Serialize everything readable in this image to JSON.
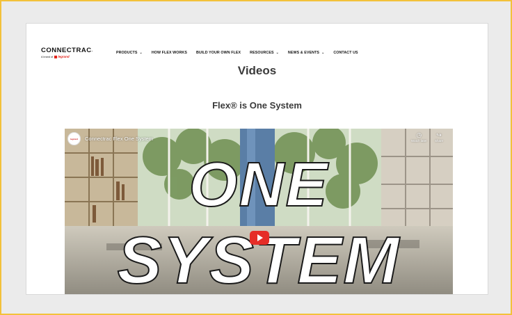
{
  "brand": {
    "name": "CONNECTRAC",
    "mark": ".",
    "tagline_prefix": "A brand of",
    "parent": "legrand"
  },
  "nav": [
    {
      "label": "PRODUCTS",
      "dropdown": true
    },
    {
      "label": "HOW FLEX WORKS",
      "dropdown": false
    },
    {
      "label": "BUILD YOUR OWN FLEX",
      "dropdown": false
    },
    {
      "label": "RESOURCES",
      "dropdown": true
    },
    {
      "label": "NEWS & EVENTS",
      "dropdown": true
    },
    {
      "label": "CONTACT US",
      "dropdown": false
    }
  ],
  "page": {
    "title": "Videos",
    "section_title": "Flex® is One System"
  },
  "video": {
    "title": "Connectrac Flex One System",
    "channel_avatar_text": "legrand",
    "watch_later_label": "Watch later",
    "share_label": "Share",
    "overlay_line1": "ONE",
    "overlay_line2": "SYSTEM"
  },
  "colors": {
    "outer_border": "#f3c13a",
    "play_button": "#e52d27",
    "legrand_red": "#e2231a"
  }
}
